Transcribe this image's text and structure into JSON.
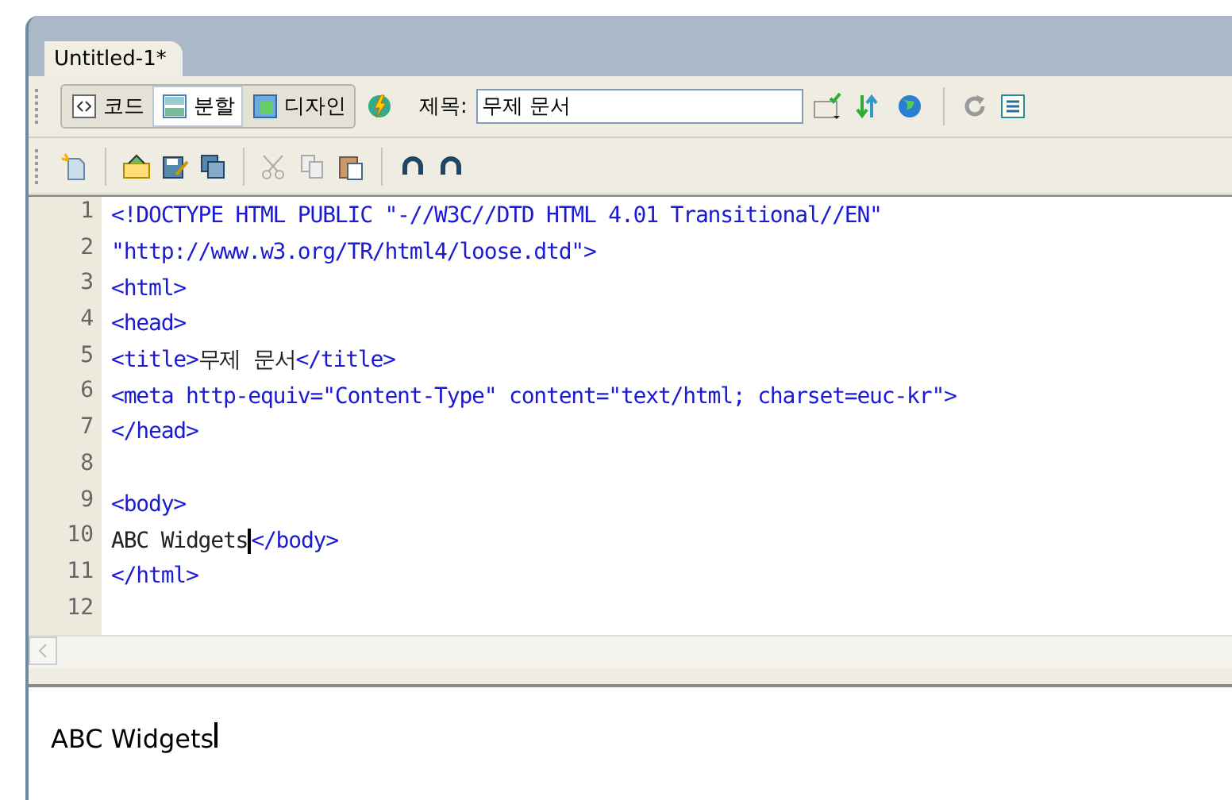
{
  "document_tab": {
    "label": "Untitled-1*",
    "selected": true
  },
  "view_buttons": [
    {
      "label": "코드",
      "selected": false
    },
    {
      "label": "분할",
      "selected": true
    },
    {
      "label": "디자인",
      "selected": false
    }
  ],
  "title_field": {
    "label": "제목:",
    "value": "무제 문서"
  },
  "code_lines": [
    {
      "number": "1",
      "segments": [
        {
          "kind": "tag",
          "text": "<!DOCTYPE HTML PUBLIC \"-//W3C//DTD HTML 4.01 Transitional//EN\""
        }
      ]
    },
    {
      "number": "2",
      "segments": [
        {
          "kind": "tag",
          "text": "\"http://www.w3.org/TR/html4/loose.dtd\">"
        }
      ]
    },
    {
      "number": "3",
      "segments": [
        {
          "kind": "tag",
          "text": "<html>"
        }
      ]
    },
    {
      "number": "4",
      "segments": [
        {
          "kind": "tag",
          "text": "<head>"
        }
      ]
    },
    {
      "number": "5",
      "segments": [
        {
          "kind": "tag",
          "text": "<title>"
        },
        {
          "kind": "text",
          "text": "무제 문서"
        },
        {
          "kind": "tag",
          "text": "</title>"
        }
      ]
    },
    {
      "number": "6",
      "segments": [
        {
          "kind": "tag",
          "text": "<meta http-equiv=\"Content-Type\" content=\"text/html; charset=euc-kr\">"
        }
      ]
    },
    {
      "number": "7",
      "segments": [
        {
          "kind": "tag",
          "text": "</head>"
        }
      ]
    },
    {
      "number": "8"
    },
    {
      "number": "9",
      "segments": [
        {
          "kind": "tag",
          "text": "<body>"
        }
      ]
    },
    {
      "number": "10",
      "segments": [
        {
          "kind": "text",
          "text": "ABC Widgets"
        },
        {
          "kind": "cursor"
        },
        {
          "kind": "tag",
          "text": "</body>"
        }
      ]
    },
    {
      "number": "11",
      "segments": [
        {
          "kind": "tag",
          "text": "</html>"
        }
      ]
    },
    {
      "number": "12"
    }
  ],
  "design_view": {
    "text": "ABC Widgets"
  }
}
